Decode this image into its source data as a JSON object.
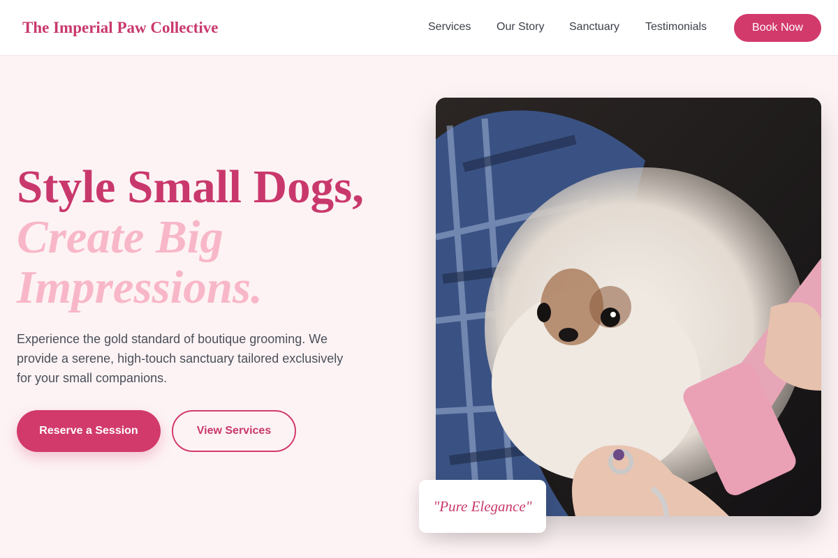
{
  "header": {
    "brand": "The Imperial Paw Collective",
    "nav": [
      "Services",
      "Our Story",
      "Sanctuary",
      "Testimonials"
    ],
    "cta": "Book Now"
  },
  "hero": {
    "headline_line1": "Style Small Dogs,",
    "headline_line2": "Create Big",
    "headline_line3": "Impressions.",
    "description": "Experience the gold standard of boutique grooming. We provide a serene, high-touch sanctuary tailored exclusively for your small companions.",
    "primary_button": "Reserve a Session",
    "secondary_button": "View Services",
    "quote": "\"Pure Elegance\""
  },
  "colors": {
    "accent": "#d23a6c",
    "accent_light": "#f8b7c8",
    "page_background": "#fdf3f4"
  }
}
